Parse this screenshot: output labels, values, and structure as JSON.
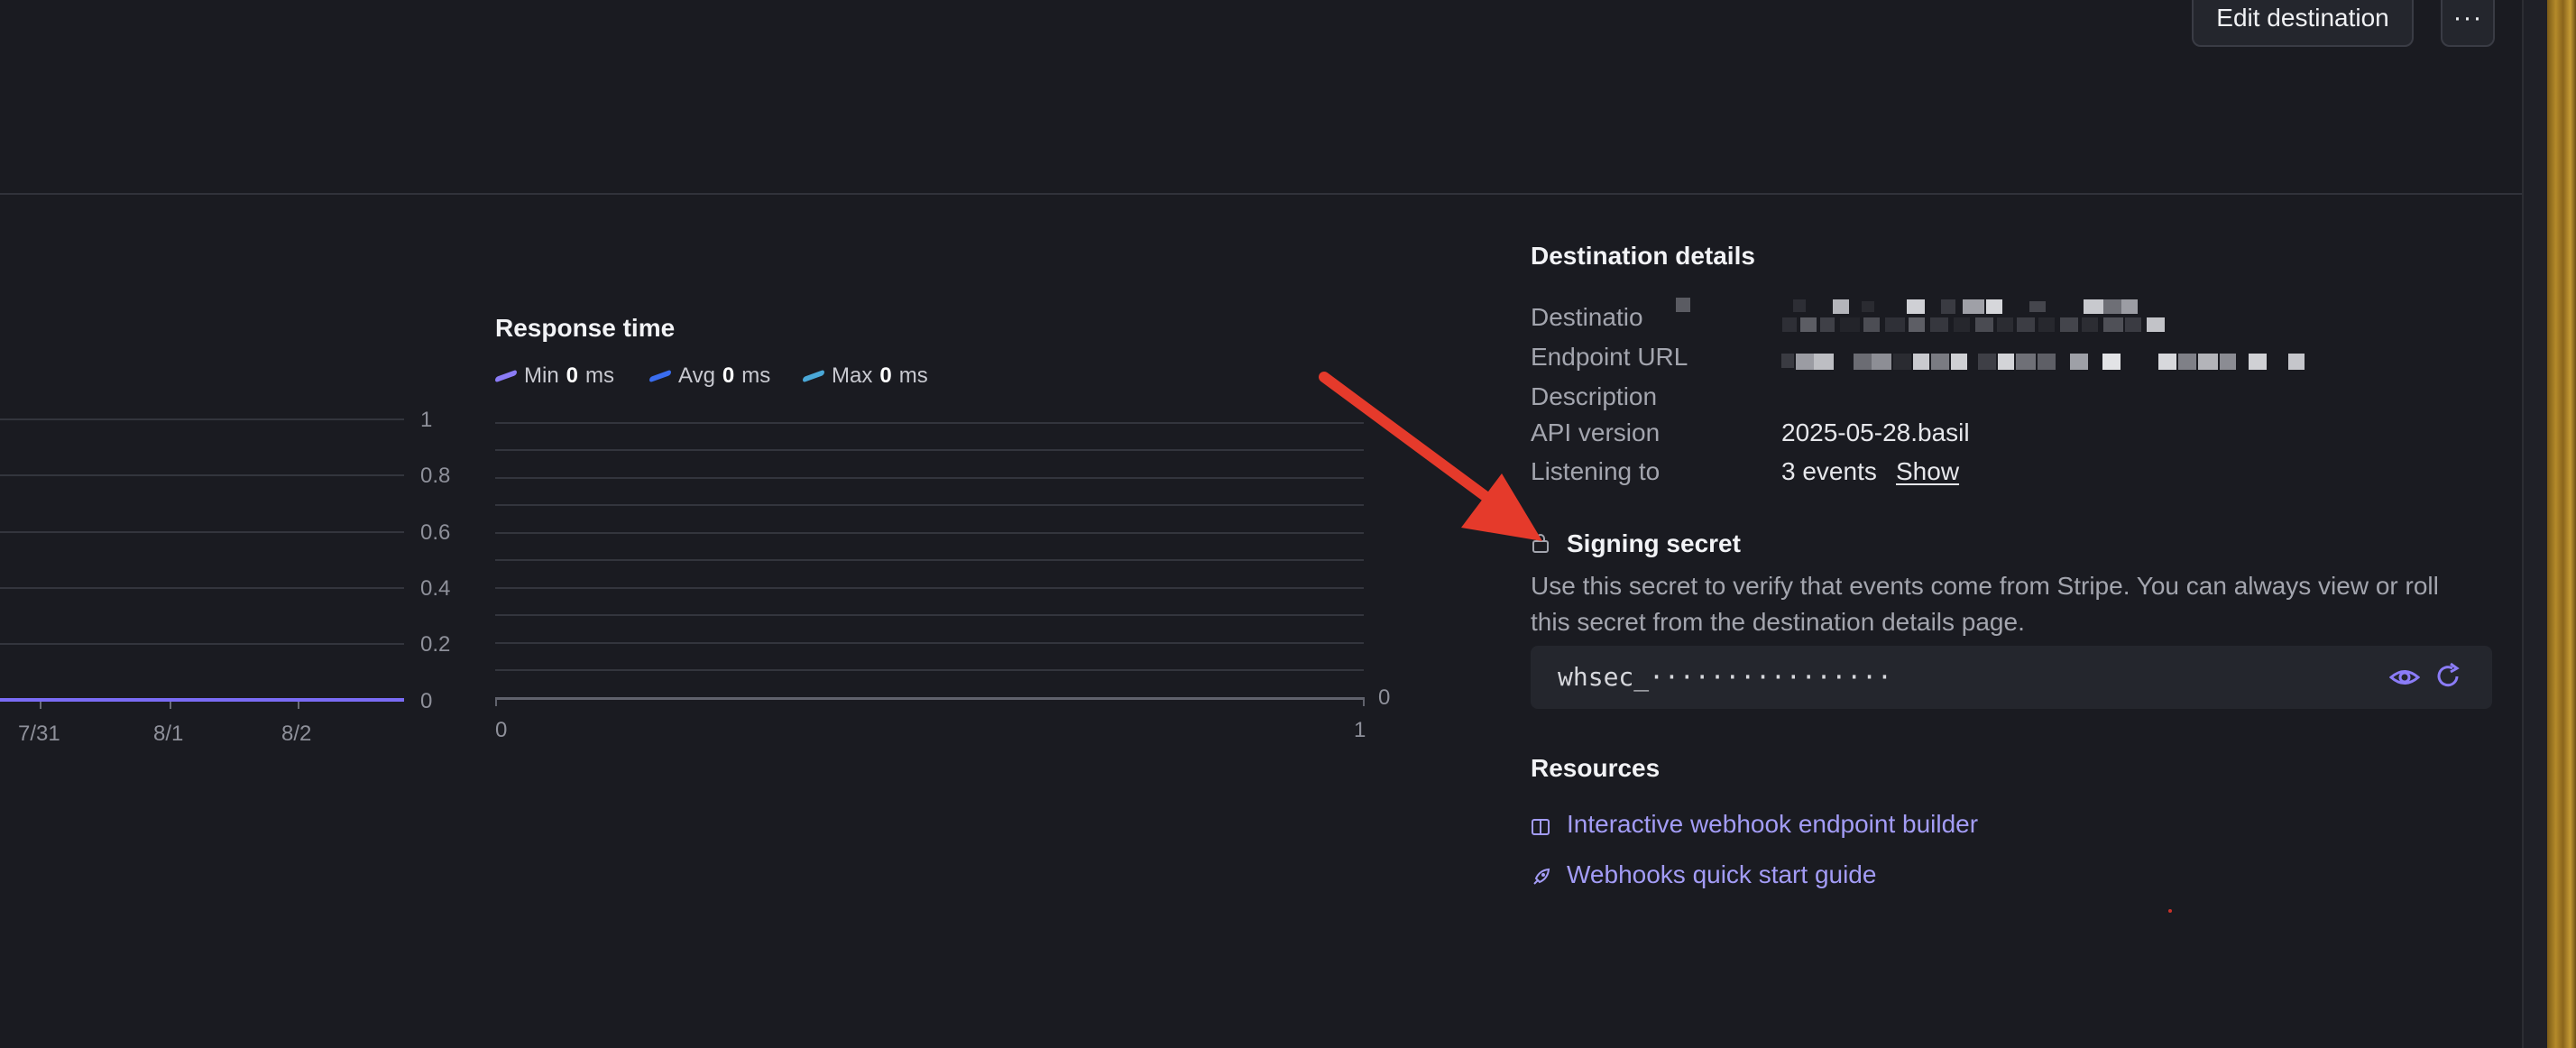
{
  "header": {
    "edit_button": "Edit destination",
    "more_button": "···"
  },
  "left_chart": {
    "y_ticks": [
      "1",
      "0.8",
      "0.6",
      "0.4",
      "0.2",
      "0"
    ],
    "x_ticks": [
      "7/31",
      "8/1",
      "8/2"
    ],
    "line_color": "#7a6cf5"
  },
  "response_chart": {
    "title": "Response time",
    "legend": [
      {
        "label": "Min",
        "value": "0",
        "unit": "ms",
        "color": "#8b7cf7"
      },
      {
        "label": "Avg",
        "value": "0",
        "unit": "ms",
        "color": "#3a6df0"
      },
      {
        "label": "Max",
        "value": "0",
        "unit": "ms",
        "color": "#4aa8d8"
      }
    ],
    "y_right_label": "0",
    "x_ticks": [
      "0",
      "1"
    ]
  },
  "chart_data": [
    {
      "type": "line",
      "title": "",
      "x": [
        "7/31",
        "8/1",
        "8/2"
      ],
      "series": [
        {
          "values": [
            0,
            0,
            0
          ]
        }
      ],
      "ylim": [
        0,
        1
      ],
      "grid": true
    },
    {
      "type": "line",
      "title": "Response time",
      "x": [
        0,
        1
      ],
      "series": [
        {
          "name": "Min",
          "values": [
            0,
            0
          ]
        },
        {
          "name": "Avg",
          "values": [
            0,
            0
          ]
        },
        {
          "name": "Max",
          "values": [
            0,
            0
          ]
        }
      ],
      "grid": true,
      "legend": "top-left"
    }
  ],
  "details": {
    "title": "Destination details",
    "rows": [
      {
        "label": "Destinatio",
        "value": ""
      },
      {
        "label": "Endpoint URL",
        "value": ""
      },
      {
        "label": "Description",
        "value": ""
      },
      {
        "label": "API version",
        "value": "2025-05-28.basil"
      },
      {
        "label": "Listening to",
        "value": "3 events"
      }
    ],
    "show_link": "Show"
  },
  "signing_secret": {
    "title": "Signing secret",
    "description_line1": "Use this secret to verify that events come from Stripe. You can always view or roll",
    "description_line2": "this secret from the destination details page.",
    "masked_value": "whsec_················",
    "reveal_icon": "eye-icon",
    "roll_icon": "refresh-icon"
  },
  "resources": {
    "title": "Resources",
    "links": [
      {
        "label": "Interactive webhook endpoint builder",
        "icon": "book-icon"
      },
      {
        "label": "Webhooks quick start guide",
        "icon": "rocket-icon"
      }
    ]
  },
  "colors": {
    "accent": "#a39cf6",
    "annotation_arrow": "#e53a2b",
    "background": "#1a1b21"
  }
}
